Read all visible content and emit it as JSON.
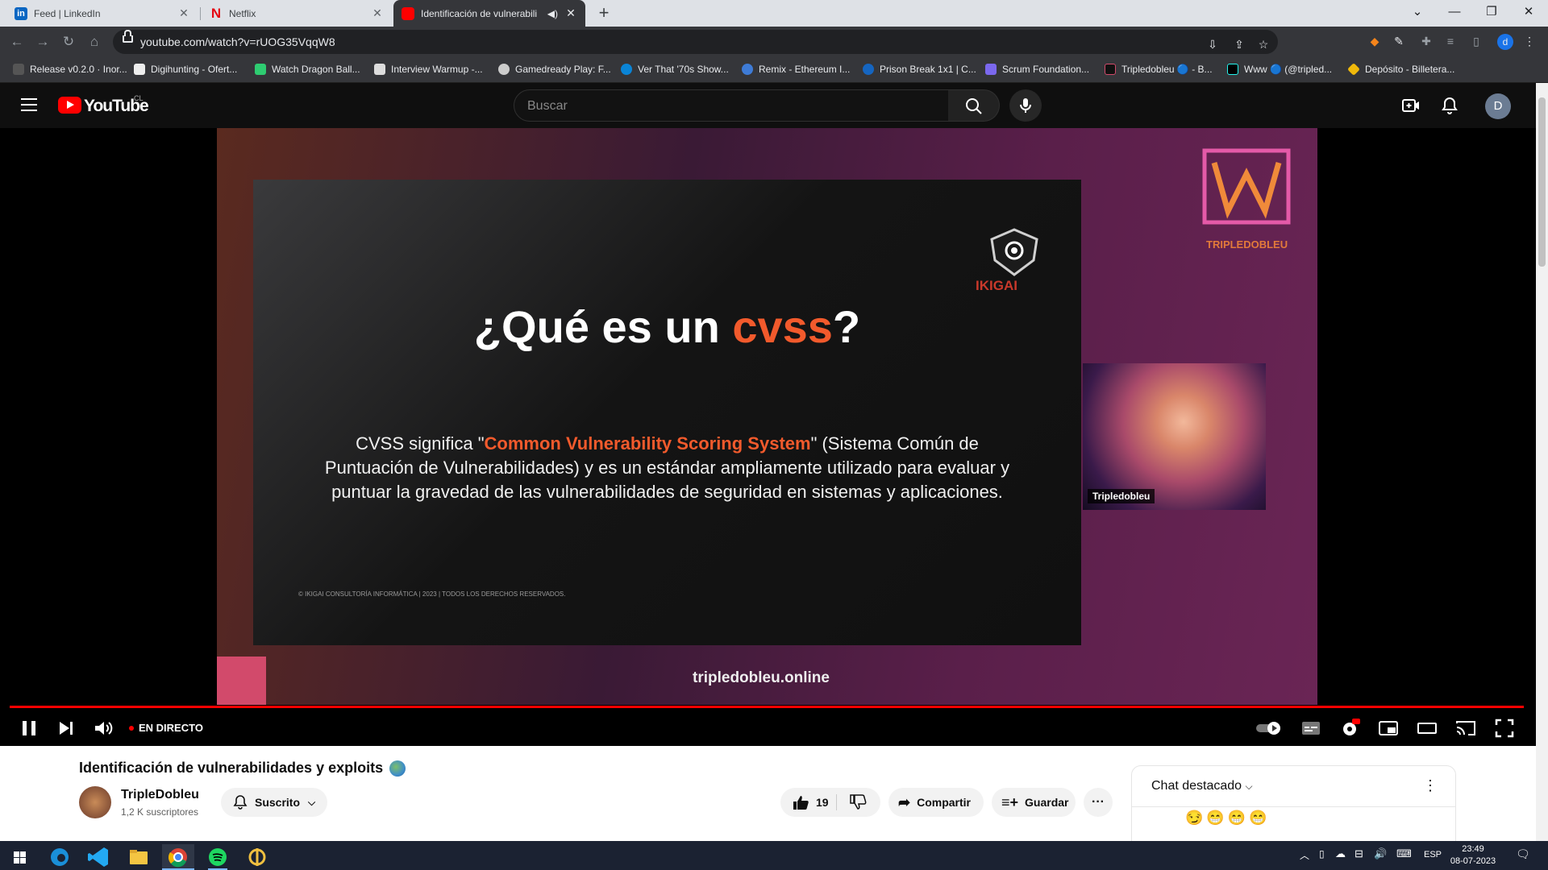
{
  "browser": {
    "tabs": [
      {
        "title": "Feed | LinkedIn",
        "icon": "linkedin-icon",
        "color": "#0a66c2"
      },
      {
        "title": "Netflix",
        "icon": "netflix-icon",
        "color": "#e50914"
      },
      {
        "title": "Identificación de vulnerabili",
        "icon": "youtube-icon",
        "color": "#ff0000",
        "active": true
      }
    ],
    "url": "youtube.com/watch?v=rUOG35VqqW8",
    "bookmarks": [
      "Release v0.2.0 · Inor...",
      "Digihunting - Ofert...",
      "Watch Dragon Ball...",
      "Interview Warmup -...",
      "Gamedready Play: F...",
      "Ver That '70s Show...",
      "Remix - Ethereum I...",
      "Prison Break 1x1 | C...",
      "Scrum Foundation...",
      "Tripledobleu 🔵 - B...",
      "Www 🔵 (@tripled...",
      "Depósito - Billetera..."
    ]
  },
  "youtube": {
    "logo_text": "YouTube",
    "region": "CL",
    "search_placeholder": "Buscar",
    "avatar_letter": "D",
    "accent": "#ff0000"
  },
  "video": {
    "slide_title_prefix": "¿Qué es un ",
    "slide_title_highlight": "cvss",
    "slide_title_suffix": "?",
    "slide_body_pre": "CVSS significa \"",
    "slide_body_highlight": "Common Vulnerability Scoring System",
    "slide_body_post": "\" (Sistema Común de Puntuación de Vulnerabilidades) y es un estándar ampliamente utilizado para evaluar y puntuar la gravedad de las vulnerabilidades de seguridad en sistemas y aplicaciones.",
    "slide_footer": "© IKIGAI CONSULTORÍA INFORMÁTICA | 2023 | TODOS LOS DERECHOS RESERVADOS.",
    "ikigai_brand": "IKIGAI",
    "overlay_brand": "TRIPLEDOBLEU",
    "cam_label": "Tripledobleu",
    "site_url": "tripledobleu.online",
    "live_label": "EN DIRECTO",
    "highlight_color": "#f25a2c"
  },
  "below": {
    "title": "Identificación de vulnerabilidades y exploits",
    "channel": "TripleDobleu",
    "subscribers": "1,2 K suscriptores",
    "subscribe_label": "Suscrito",
    "likes": "19",
    "share_label": "Compartir",
    "save_label": "Guardar",
    "chat_title": "Chat destacado",
    "chat_emoji": "😏😁😁😁"
  },
  "taskbar": {
    "time": "23:49",
    "date": "08-07-2023",
    "language": "ESP"
  }
}
